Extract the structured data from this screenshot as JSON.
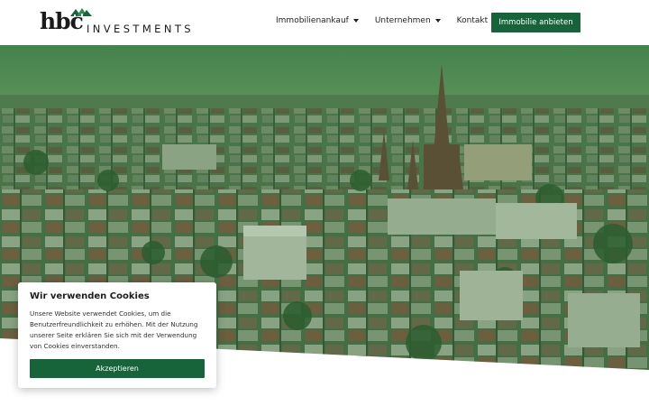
{
  "brand": {
    "logo_main": "hbc",
    "logo_sub": "INVESTMENTS",
    "accent": "#17643a"
  },
  "nav": {
    "items": [
      {
        "label": "Immobilienankauf",
        "has_dropdown": true
      },
      {
        "label": "Unternehmen",
        "has_dropdown": true
      },
      {
        "label": "Kontakt",
        "has_dropdown": false
      }
    ],
    "cta_label": "Immobilie anbieten"
  },
  "hero": {
    "image": "aerial-city-view-green-tint"
  },
  "cookie_banner": {
    "title": "Wir verwenden Cookies",
    "text": "Unsere Website verwendet Cookies, um die Benutzerfreundlichkeit zu erhöhen. Mit der Nutzung unserer Seite erklären Sie sich mit der Verwendung von Cookies einverstanden.",
    "accept_label": "Akzeptieren"
  },
  "icons": {
    "dropdown": "chevron-down-icon",
    "logo_mark": "house-roofs-icon"
  }
}
